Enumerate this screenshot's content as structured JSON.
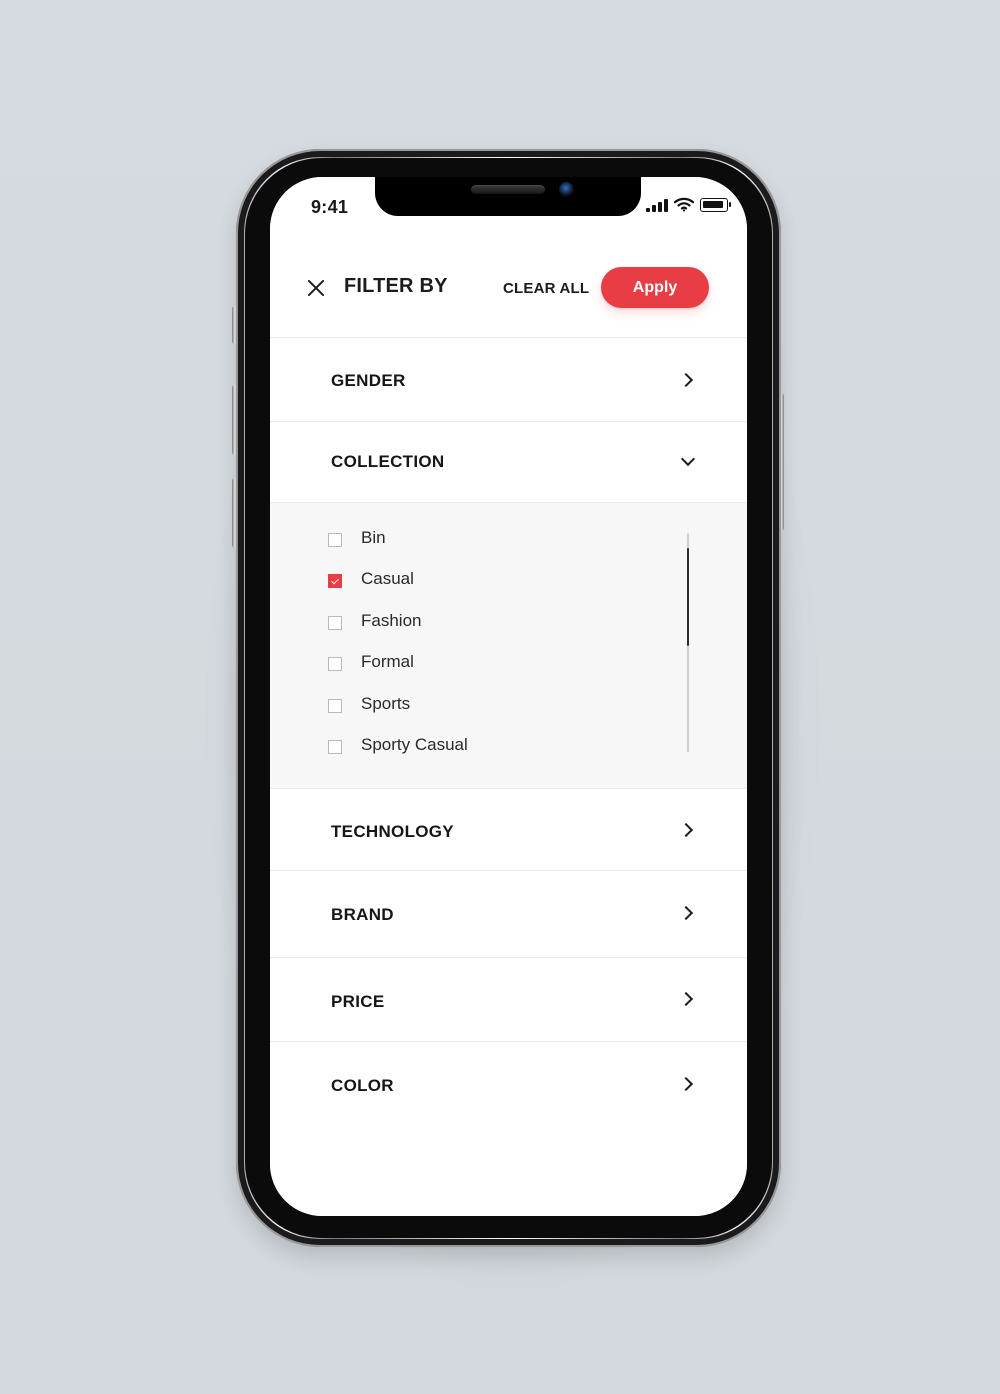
{
  "status_bar": {
    "time": "9:41"
  },
  "icons": {
    "close": "close-icon",
    "chevron_right": "chevron-right-icon",
    "chevron_down": "chevron-down-icon",
    "signal": "signal-icon",
    "wifi": "wifi-icon",
    "battery": "battery-icon",
    "checkbox_checked": "checkbox-checked-icon",
    "checkbox_unchecked": "checkbox-unchecked-icon"
  },
  "header": {
    "title": "FILTER BY",
    "clear_all_label": "CLEAR ALL",
    "apply_label": "Apply"
  },
  "sections": {
    "gender": "GENDER",
    "collection": "COLLECTION",
    "technology": "TECHNOLOGY",
    "brand": "BRAND",
    "price": "PRICE",
    "color": "COLOR"
  },
  "collection_options": [
    {
      "label": "Bin",
      "checked": false
    },
    {
      "label": "Casual",
      "checked": true
    },
    {
      "label": "Fashion",
      "checked": false
    },
    {
      "label": "Formal",
      "checked": false
    },
    {
      "label": "Sports",
      "checked": false
    },
    {
      "label": "Sporty Casual",
      "checked": false
    }
  ],
  "colors": {
    "accent": "#E93D45",
    "text_primary": "#161616",
    "panel_background": "#F7F7F7",
    "divider": "#ECECEC"
  }
}
